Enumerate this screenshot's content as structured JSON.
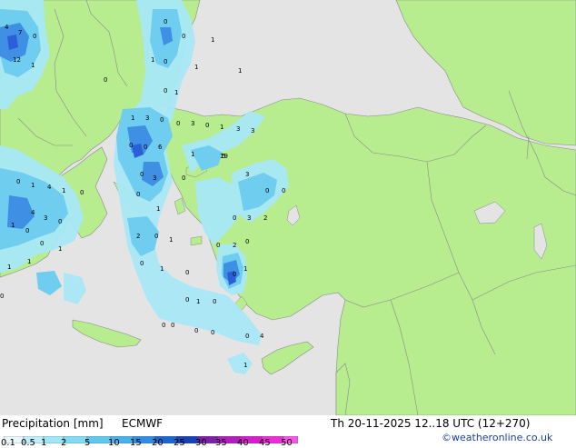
{
  "footer": {
    "title": "Precipitation [mm]",
    "model": "ECMWF",
    "valid_time": "Th 20-11-2025 12..18 UTC (12+270)",
    "credit": "©weatheronline.co.uk"
  },
  "legend": {
    "ticks": [
      "0.1",
      "0.5",
      "1",
      "2",
      "5",
      "10",
      "15",
      "20",
      "25",
      "30",
      "35",
      "40",
      "45",
      "50"
    ],
    "colors": [
      "#e8f8fc",
      "#bff0fa",
      "#9ee7f6",
      "#7fdcf2",
      "#5ec8ee",
      "#46b2ea",
      "#2f8ee2",
      "#1c66d4",
      "#1840b8",
      "#7f1fa8",
      "#b21cc0",
      "#d81ccf",
      "#ee2cd8",
      "#f852e6"
    ]
  },
  "map": {
    "colors": {
      "sea": "#e4e4e4",
      "land": "#b7ec8f",
      "border": "#8a8a8a",
      "light_precip": "#a8e8f6",
      "mid_precip": "#6fcdf0",
      "heavy_precip": "#3f8fe4",
      "core_precip": "#2a5fd8"
    },
    "labels": [
      {
        "text": "4"
      },
      {
        "text": "7"
      },
      {
        "text": "0"
      },
      {
        "text": "12"
      },
      {
        "text": "1"
      },
      {
        "text": "0"
      },
      {
        "text": "0"
      },
      {
        "text": "1"
      },
      {
        "text": "1"
      },
      {
        "text": "0"
      },
      {
        "text": "1"
      },
      {
        "text": "1"
      },
      {
        "text": "0"
      },
      {
        "text": "0"
      },
      {
        "text": "1"
      },
      {
        "text": "1"
      },
      {
        "text": "3"
      },
      {
        "text": "0"
      },
      {
        "text": "0"
      },
      {
        "text": "3"
      },
      {
        "text": "0"
      },
      {
        "text": "1"
      },
      {
        "text": "3"
      },
      {
        "text": "3"
      },
      {
        "text": "0"
      },
      {
        "text": "0"
      },
      {
        "text": "6"
      },
      {
        "text": "1"
      },
      {
        "text": "19"
      },
      {
        "text": "0"
      },
      {
        "text": "3"
      },
      {
        "text": "0"
      },
      {
        "text": "3"
      },
      {
        "text": "0"
      },
      {
        "text": "1"
      },
      {
        "text": "4"
      },
      {
        "text": "1"
      },
      {
        "text": "0"
      },
      {
        "text": "4"
      },
      {
        "text": "3"
      },
      {
        "text": "0"
      },
      {
        "text": "1"
      },
      {
        "text": "0"
      },
      {
        "text": "0"
      },
      {
        "text": "1"
      },
      {
        "text": "2"
      },
      {
        "text": "0"
      },
      {
        "text": "1"
      },
      {
        "text": "0"
      },
      {
        "text": "0"
      },
      {
        "text": "3"
      },
      {
        "text": "2"
      },
      {
        "text": "0"
      },
      {
        "text": "1"
      },
      {
        "text": "0"
      },
      {
        "text": "2"
      },
      {
        "text": "0"
      },
      {
        "text": "0"
      },
      {
        "text": "1"
      },
      {
        "text": "0"
      },
      {
        "text": "0"
      },
      {
        "text": "1"
      },
      {
        "text": "0"
      },
      {
        "text": "1"
      },
      {
        "text": "0"
      },
      {
        "text": "0"
      },
      {
        "text": "1"
      },
      {
        "text": "4"
      },
      {
        "text": "0"
      },
      {
        "text": "0"
      },
      {
        "text": "0"
      },
      {
        "text": "1"
      },
      {
        "text": "0"
      },
      {
        "text": "0"
      },
      {
        "text": "5"
      },
      {
        "text": "1"
      },
      {
        "text": "0"
      }
    ]
  }
}
